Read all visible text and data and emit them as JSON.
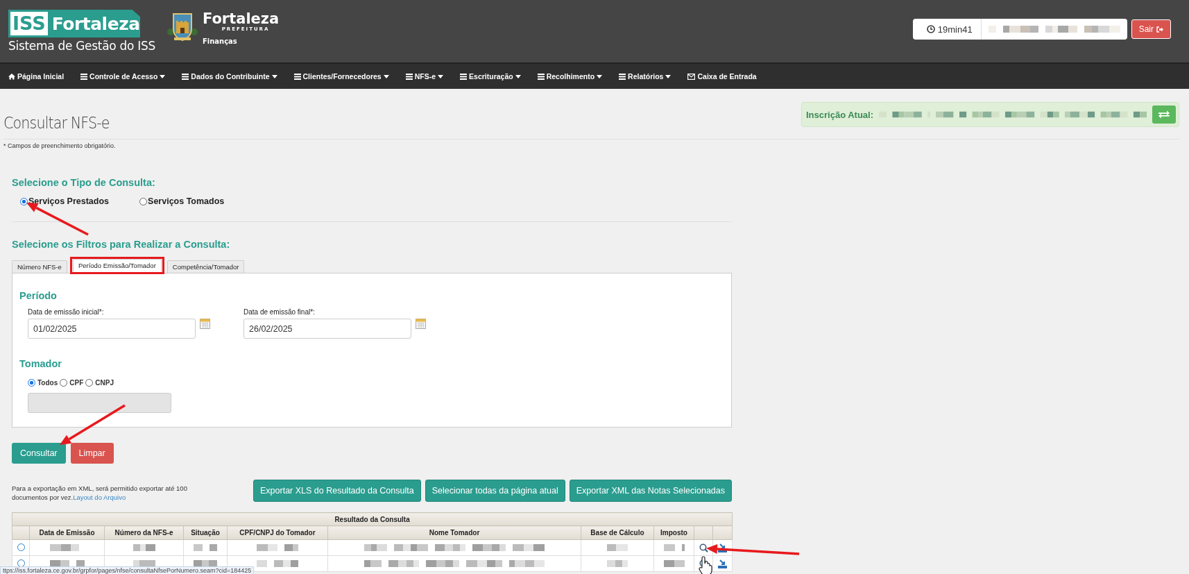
{
  "header": {
    "logo_badge": "ISS",
    "logo_name": "Fortaleza",
    "subtitle": "Sistema de Gestão do ISS",
    "city_name": "Fortaleza",
    "city_sub": "PREFEITURA",
    "city_dept": "Finanças",
    "timer": "19min41",
    "logout": "Sair"
  },
  "nav": [
    {
      "label": "Página Inicial",
      "kind": "home",
      "dropdown": false
    },
    {
      "label": "Controle de Acesso",
      "kind": "menu",
      "dropdown": true
    },
    {
      "label": "Dados do Contribuinte",
      "kind": "menu",
      "dropdown": true
    },
    {
      "label": "Clientes/Fornecedores",
      "kind": "menu",
      "dropdown": true
    },
    {
      "label": "NFS-e",
      "kind": "menu",
      "dropdown": true
    },
    {
      "label": "Escrituração",
      "kind": "menu",
      "dropdown": true
    },
    {
      "label": "Recolhimento",
      "kind": "menu",
      "dropdown": true
    },
    {
      "label": "Relatórios",
      "kind": "menu",
      "dropdown": true
    },
    {
      "label": "Caixa de Entrada",
      "kind": "inbox",
      "dropdown": false
    }
  ],
  "inscricao": {
    "label": "Inscrição Atual:"
  },
  "page": {
    "title": "Consultar NFS-e",
    "note": "* Campos de preenchimento obrigatório."
  },
  "tipo": {
    "heading": "Selecione o Tipo de Consulta:",
    "options": [
      {
        "label": "Serviços Prestados",
        "selected": true
      },
      {
        "label": "Serviços Tomados",
        "selected": false
      }
    ]
  },
  "filtros": {
    "heading": "Selecione os Filtros para Realizar a Consulta:",
    "tabs": [
      {
        "label": "Número NFS-e",
        "selected": false
      },
      {
        "label": "Período Emissão/Tomador",
        "selected": true
      },
      {
        "label": "Competência/Tomador",
        "selected": false
      }
    ]
  },
  "periodo": {
    "heading": "Período",
    "fields": [
      {
        "label": "Data de emissão inicial*:",
        "value": "01/02/2025"
      },
      {
        "label": "Data de emissão final*:",
        "value": "26/02/2025"
      }
    ]
  },
  "tomador": {
    "heading": "Tomador",
    "options": [
      {
        "label": "Todos",
        "selected": true
      },
      {
        "label": "CPF",
        "selected": false
      },
      {
        "label": "CNPJ",
        "selected": false
      }
    ],
    "document_field": {
      "disabled": true
    }
  },
  "actions": [
    {
      "label": "Consultar",
      "kind": "primary"
    },
    {
      "label": "Limpar",
      "kind": "danger"
    }
  ],
  "export": {
    "note": "Para a exportação em XML, será permitido exportar até 100 documentos por vez.",
    "link": "Layout do Arquivo",
    "buttons": [
      "Exportar XLS do Resultado da Consulta",
      "Selecionar todas da página atual",
      "Exportar XML das Notas Selecionadas"
    ]
  },
  "results": {
    "title": "Resultado da Consulta",
    "columns": [
      "Data de Emissão",
      "Número da NFS-e",
      "Situação",
      "CPF/CNPJ do Tomador",
      "Nome Tomador",
      "Base de Cálculo",
      "Imposto"
    ],
    "rows": [
      {
        "selected": false
      },
      {
        "selected": false
      }
    ]
  },
  "status_url": "ttps://iss.fortaleza.ce.gov.br/grpfor/pages/nfse/consultaNfsePorNumero.seam?cid=184425"
}
